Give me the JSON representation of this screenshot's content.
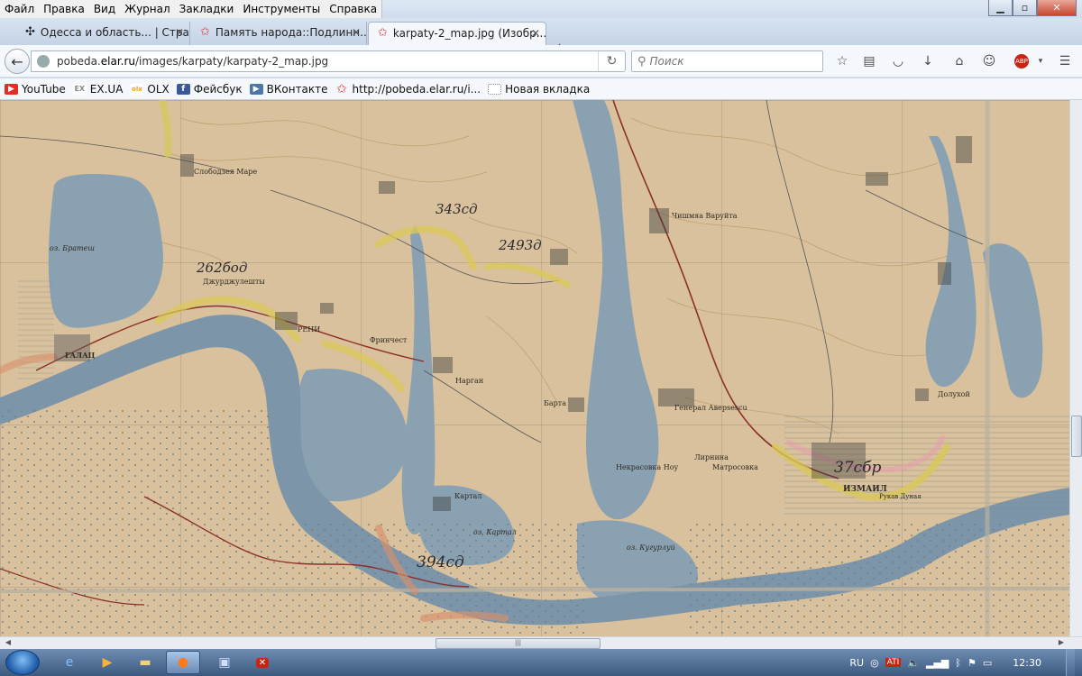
{
  "menu": [
    "Файл",
    "Правка",
    "Вид",
    "Журнал",
    "Закладки",
    "Инструменты",
    "Справка"
  ],
  "window_controls": {
    "minimize": "▁",
    "maximize": "▫",
    "close": "✕"
  },
  "tabs": [
    {
      "title": "Одесса и область... | Стра...",
      "icon": "cross-icon",
      "active": false
    },
    {
      "title": "Память народа::Подлинн...",
      "icon": "star-icon",
      "active": false
    },
    {
      "title": "karpaty-2_map.jpg (Изобр...",
      "icon": "star-icon",
      "active": true
    }
  ],
  "new_tab": "+",
  "url": {
    "prefix": "pobeda.",
    "domain": "elar.ru",
    "path": "/images/karpaty/karpaty-2_map.jpg"
  },
  "search": {
    "placeholder": "Поиск"
  },
  "abp_label": "ABP",
  "bookmarks": [
    {
      "label": "YouTube",
      "icon": "youtube-icon",
      "color": "#e52d27"
    },
    {
      "label": "EX.UA",
      "icon": "exua-icon",
      "color": "#8a8a8a"
    },
    {
      "label": "OLX",
      "icon": "olx-icon",
      "color": "#f0a000"
    },
    {
      "label": "Фейсбук",
      "icon": "facebook-icon",
      "color": "#3b5998"
    },
    {
      "label": "ВКонтакте",
      "icon": "vk-icon",
      "color": "#4a76a8"
    },
    {
      "label": "http://pobeda.elar.ru/i...",
      "icon": "star-icon",
      "color": "#d33"
    },
    {
      "label": "Новая вкладка",
      "icon": "blank-page-icon",
      "color": "#ffffff"
    }
  ],
  "map": {
    "place_labels": [
      {
        "id": "reni",
        "text": "РЕНИ"
      },
      {
        "id": "izmail",
        "text": "ИЗМАИЛ"
      },
      {
        "id": "bratesh",
        "text": "оз. Братеш"
      },
      {
        "id": "slobodzeya",
        "text": "Слободзея Маре"
      },
      {
        "id": "dzhurdzhuleshty",
        "text": "Джурджулешты"
      },
      {
        "id": "frincest",
        "text": "Фринчест"
      },
      {
        "id": "nargan",
        "text": "Нарган"
      },
      {
        "id": "barta",
        "text": "Барта"
      },
      {
        "id": "kartal",
        "text": "Картал"
      },
      {
        "id": "chishmya",
        "text": "Чишмяа Варуйта"
      },
      {
        "id": "avrescu",
        "text": "Генерал Аверsescu"
      },
      {
        "id": "nekrasovka",
        "text": "Некрасовка Ноу"
      },
      {
        "id": "matrosovka",
        "text": "Матросовка"
      },
      {
        "id": "kugurlui",
        "text": "оз. Кугурлуй"
      },
      {
        "id": "kartal_lake",
        "text": "оз. Картал"
      },
      {
        "id": "dolukhoy",
        "text": "Долухой"
      },
      {
        "id": "izmail_channel",
        "text": "Рукав Дуная"
      },
      {
        "id": "galat",
        "text": "ГАЛАЦ"
      },
      {
        "id": "vorona",
        "text": "Лирнина"
      }
    ],
    "pencil_annotations": [
      "343сд",
      "262бод",
      "2493д",
      "37сбр",
      "394сд"
    ]
  },
  "taskbar": {
    "apps": [
      {
        "name": "start",
        "icon": "windows-start-icon"
      },
      {
        "name": "ie",
        "icon": "ie-icon"
      },
      {
        "name": "media",
        "icon": "media-player-icon"
      },
      {
        "name": "explorer",
        "icon": "folder-icon"
      },
      {
        "name": "firefox",
        "icon": "firefox-icon"
      },
      {
        "name": "save",
        "icon": "floppy-icon"
      },
      {
        "name": "antivirus",
        "icon": "shield-icon"
      }
    ],
    "tray": {
      "lang": "RU",
      "ati": "ATI"
    },
    "clock": "12:30"
  },
  "colors": {
    "accent": "#3c5a80",
    "map_paper": "#d9c29f",
    "water": "#8aa1b2"
  }
}
